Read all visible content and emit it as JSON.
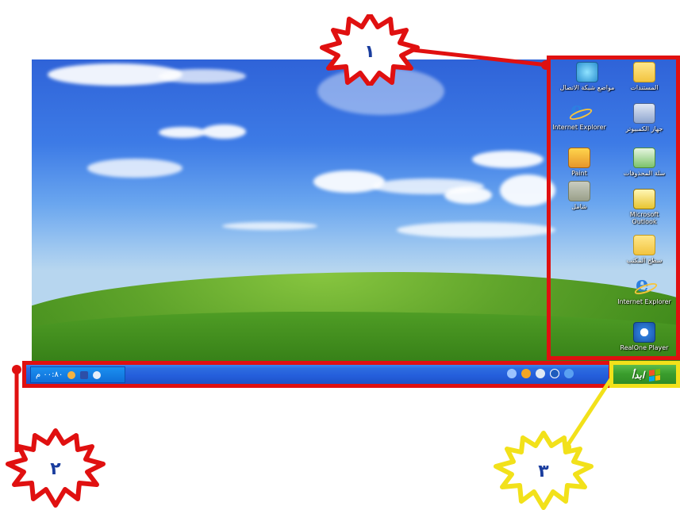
{
  "desktop": {
    "icons": [
      {
        "label": "المستندات",
        "icon": "folder-icon"
      },
      {
        "label": "مواضع شبكة الاتصال",
        "icon": "network-places-icon"
      },
      {
        "label": "جهاز الكمبيوتر",
        "icon": "my-computer-icon"
      },
      {
        "label": "Internet Explorer",
        "icon": "internet-explorer-icon"
      },
      {
        "label": "سلة المحذوفات",
        "icon": "recycle-bin-icon"
      },
      {
        "label": "Paint",
        "icon": "paint-icon"
      },
      {
        "label": "Microsoft Outlook",
        "icon": "outlook-icon"
      },
      {
        "label": "شامل",
        "icon": "folder-icon"
      },
      {
        "label": "سطح المكتب",
        "icon": "folder-icon"
      },
      {
        "label": "Internet Explorer",
        "icon": "internet-explorer-icon"
      },
      {
        "label": "RealOne Player",
        "icon": "realone-player-icon"
      }
    ]
  },
  "taskbar": {
    "start_label": "ابدأ",
    "clock": "٠٠:٨٠ م"
  },
  "callouts": {
    "one": "١",
    "two": "٢",
    "three": "٣"
  },
  "colors": {
    "frame_red": "#e01010",
    "frame_yellow": "#f2e11a",
    "taskbar_blue": "#245edb",
    "start_green": "#3a9d2d"
  }
}
